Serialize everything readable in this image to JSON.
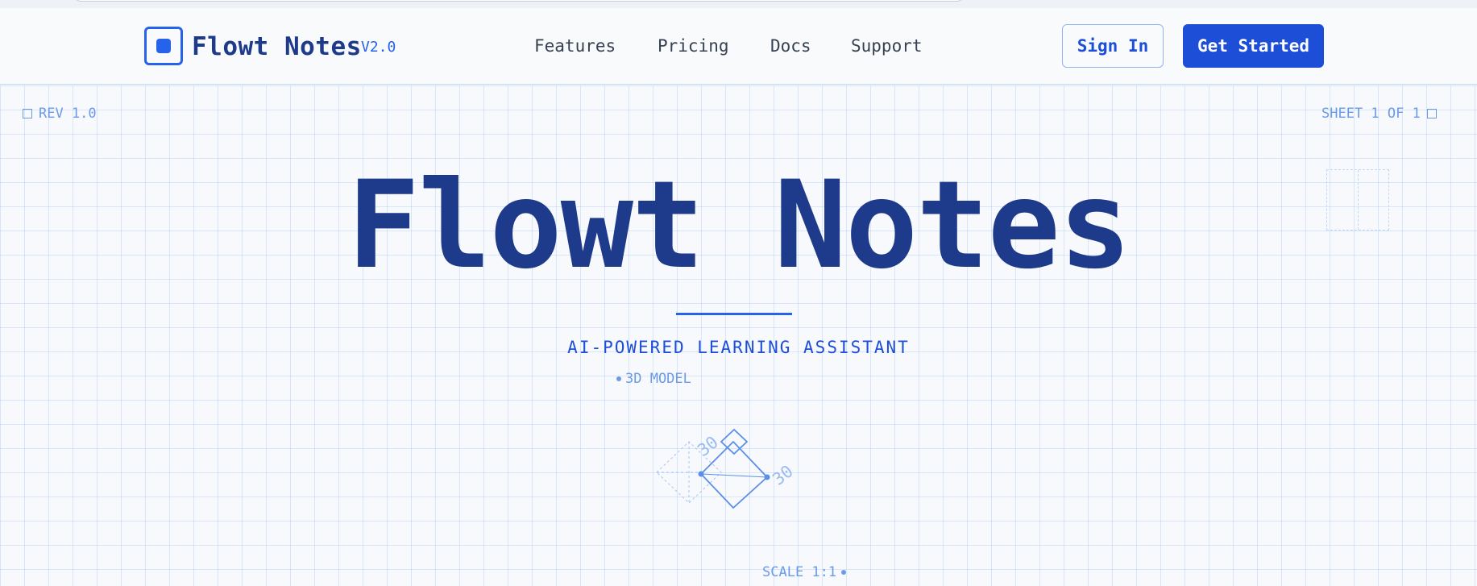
{
  "header": {
    "brand": "Flowt Notes",
    "version": "V2.0",
    "nav": [
      "Features",
      "Pricing",
      "Docs",
      "Support"
    ],
    "sign_in": "Sign In",
    "get_started": "Get Started"
  },
  "sheet": {
    "rev": "REV 1.0",
    "sheet": "SHEET 1 OF 1",
    "scale": "SCALE 1:1"
  },
  "hero": {
    "title": "Flowt Notes",
    "tagline": "AI-POWERED LEARNING ASSISTANT",
    "model_label": "3D MODEL",
    "dim_a": "30",
    "dim_b": "30"
  },
  "colors": {
    "primary": "#1d4ed8",
    "navy": "#1e3a8a",
    "grid": "#dbe7fb",
    "muted_blue": "#6b9be8"
  }
}
